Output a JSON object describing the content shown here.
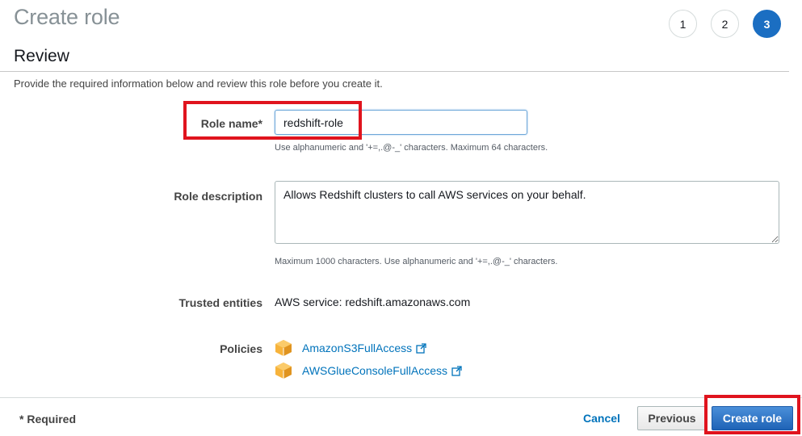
{
  "header": {
    "title": "Create role",
    "steps": [
      "1",
      "2",
      "3"
    ],
    "active_step": "3"
  },
  "review": {
    "title": "Review",
    "intro": "Provide the required information below and review this role before you create it."
  },
  "form": {
    "role_name": {
      "label": "Role name*",
      "value": "redshift-role",
      "hint": "Use alphanumeric and '+=,.@-_' characters. Maximum 64 characters."
    },
    "role_description": {
      "label": "Role description",
      "value": "Allows Redshift clusters to call AWS services on your behalf.",
      "hint": "Maximum 1000 characters. Use alphanumeric and '+=,.@-_' characters."
    },
    "trusted_entities": {
      "label": "Trusted entities",
      "value": "AWS service: redshift.amazonaws.com"
    },
    "policies": {
      "label": "Policies",
      "items": [
        {
          "name": "AmazonS3FullAccess",
          "icon": "aws-policy-cube-icon"
        },
        {
          "name": "AWSGlueConsoleFullAccess",
          "icon": "aws-policy-cube-icon"
        }
      ]
    }
  },
  "footer": {
    "required_note": "* Required",
    "cancel": "Cancel",
    "previous": "Previous",
    "create": "Create role"
  },
  "colors": {
    "accent": "#1b6ec2",
    "link": "#0073bb",
    "highlight": "#e0141e",
    "policy_icon": "#f5a623"
  }
}
